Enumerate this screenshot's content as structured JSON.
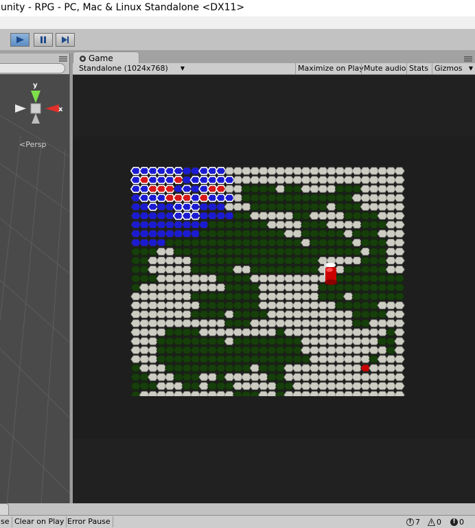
{
  "window": {
    "title": "unity - RPG - PC, Mac & Linux Standalone <DX11>"
  },
  "toolbar": {
    "play": "play-icon",
    "pause": "pause-icon",
    "step": "step-icon"
  },
  "scene": {
    "persp_label": "Persp",
    "axis_y": "y",
    "axis_x": "x"
  },
  "game": {
    "tab_label": "Game",
    "resolution": "Standalone (1024x768)",
    "maximize_on_play": "Maximize on Play",
    "mute_audio": "Mute audio",
    "stats": "Stats",
    "gizmos": "Gizmos"
  },
  "board": {
    "legend": {
      ".": "#cdcdc4",
      "g": "#173f0b",
      "b": "#1b1bd2",
      "B": "#1b1bd2",
      "r": "#d61818",
      "R": "#d61818",
      "h": "#c80000"
    },
    "rows": [
      "BBBBBBbbBBB.....................",
      "BRBBBRbBBBBB....................",
      "BBRRRbBbBRR..gggg.gg....ggg.....",
      "bBBBRRRBRBBB.ggggggggggggg......",
      "bbBbbBBBbbb...ggggggggg.ggg.....",
      "bbbbbBBBbbbbgg.....gg....gggg...",
      "bbbbbbbbbggggggg....ggg....ggg..",
      "bbbbbbbbgggggggggg..ggggg.ggg...",
      "bbbbgggggggggggggggg.ggggg.ggg..",
      "ggg..gggggggggggggggggggggg.gg..",
      "gg.....ggggggggggggggg.....ggg..",
      "gg.....ggggg..gggggggg...ggggg..",
      "ggg.......gggg.........ggggggggg",
      "g..........gggg.......gggggggggg",
      ".......gggggggg.......ggg.gggggg",
      "........ggggggg.........ggggg...",
      ".......gggg.gggg..........gggg..",
      "...........ggg............gg....",
      "....gggg.........g............g.",
      "...gggggggg.gggggggg.........gg.",
      "...ggggggggggggggggg..........g.",
      "...gggggggggggggggggg.......g...",
      "g...gggggggggg.ggg.........h....",
      "gg...ggg..g.....gg..............",
      "ggg...gg.ggg.....gg.............",
      "g...........ggg..g.............."
    ]
  },
  "console": {
    "collapse": "se",
    "clear_on_play": "Clear on Play",
    "error_pause": "Error Pause",
    "info_count": "7",
    "warning_count": "0",
    "error_count": "0"
  }
}
